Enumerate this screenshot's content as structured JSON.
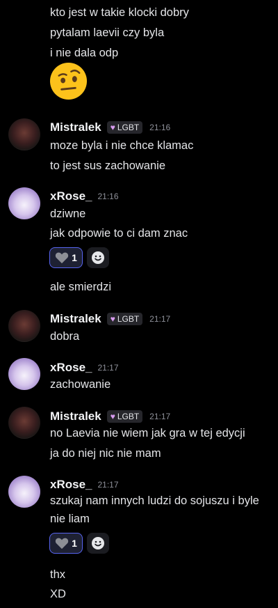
{
  "messages": {
    "top_lines": [
      "kto jest w takie klocki dobry",
      "pytalam laevii czy byla",
      "i nie dala odp"
    ],
    "top_emoji": "face-with-raised-eyebrow",
    "m1": {
      "user": "Mistralek",
      "role": "LGBT",
      "time": "21:16",
      "lines": [
        "moze byla i nie chce klamac",
        "to jest sus zachowanie"
      ]
    },
    "r1": {
      "user": "xRose_",
      "time": "21:16",
      "lines": [
        "dziwne",
        "jak odpowie to ci dam znac"
      ],
      "reaction_count": "1",
      "after_reaction": "ale smierdzi"
    },
    "m2": {
      "user": "Mistralek",
      "role": "LGBT",
      "time": "21:17",
      "lines": [
        "dobra"
      ]
    },
    "r2": {
      "user": "xRose_",
      "time": "21:17",
      "lines": [
        "zachowanie"
      ]
    },
    "m3": {
      "user": "Mistralek",
      "role": "LGBT",
      "time": "21:17",
      "lines": [
        "no Laevia nie wiem jak gra w tej edycji",
        "ja do niej nic nie mam"
      ]
    },
    "r3": {
      "user": "xRose_",
      "time": "21:17",
      "lines": [
        "szukaj nam innych ludzi do sojuszu i byle",
        "nie liam"
      ],
      "reaction_count": "1",
      "after_reaction": [
        "thx",
        "XD"
      ]
    }
  },
  "colors": {
    "background": "#000000",
    "reaction_border": "#5865f2",
    "role_heart": "#d99cf0"
  }
}
